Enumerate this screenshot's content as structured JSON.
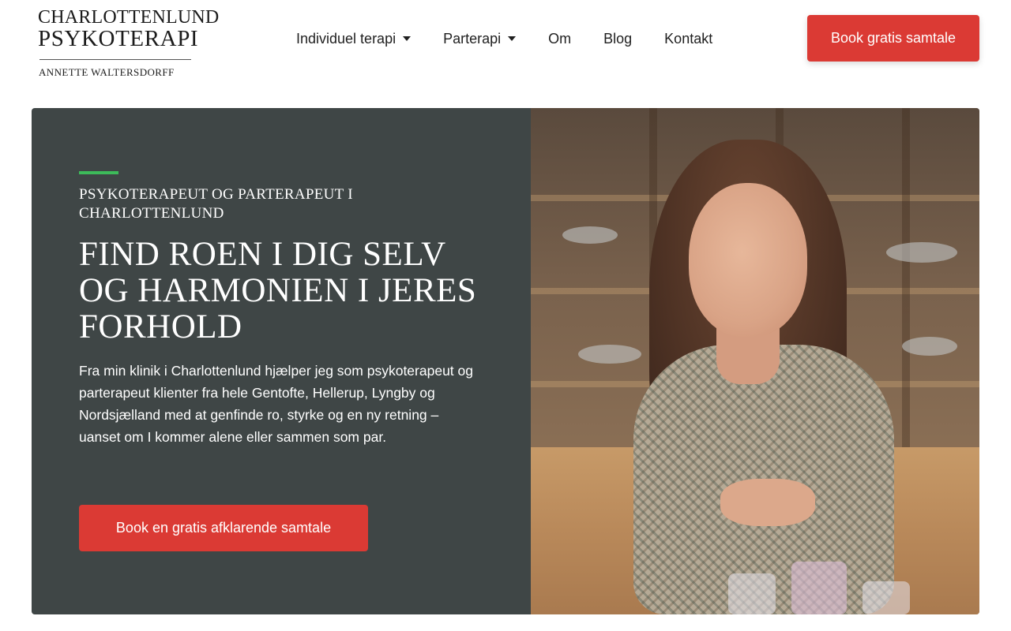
{
  "logo": {
    "line1": "CHARLOTTENLUND",
    "line2": "PSYKOTERAPI",
    "line3": "ANNETTE WALTERSDORFF"
  },
  "nav": {
    "items": [
      {
        "label": "Individuel terapi",
        "has_dropdown": true
      },
      {
        "label": "Parterapi",
        "has_dropdown": true
      },
      {
        "label": "Om",
        "has_dropdown": false
      },
      {
        "label": "Blog",
        "has_dropdown": false
      },
      {
        "label": "Kontakt",
        "has_dropdown": false
      }
    ],
    "cta_label": "Book gratis samtale"
  },
  "hero": {
    "eyebrow": "PSYKOTERAPEUT OG PARTERAPEUT I CHARLOTTENLUND",
    "headline": "FIND ROEN I DIG SELV OG HARMONIEN I JERES FORHOLD",
    "intro": "Fra min klinik i Charlottenlund hjælper jeg som psykoterapeut og parterapeut klienter fra hele Gentofte, Hellerup, Lyngby og Nordsjælland med at genfinde ro, styrke og en ny retning – uanset om I kommer alene eller sammen som par.",
    "cta_label": "Book en gratis afklarende samtale"
  },
  "colors": {
    "accent_red": "#db3a34",
    "panel_bg": "#3f4646",
    "accent_green": "#3dbb5a"
  }
}
